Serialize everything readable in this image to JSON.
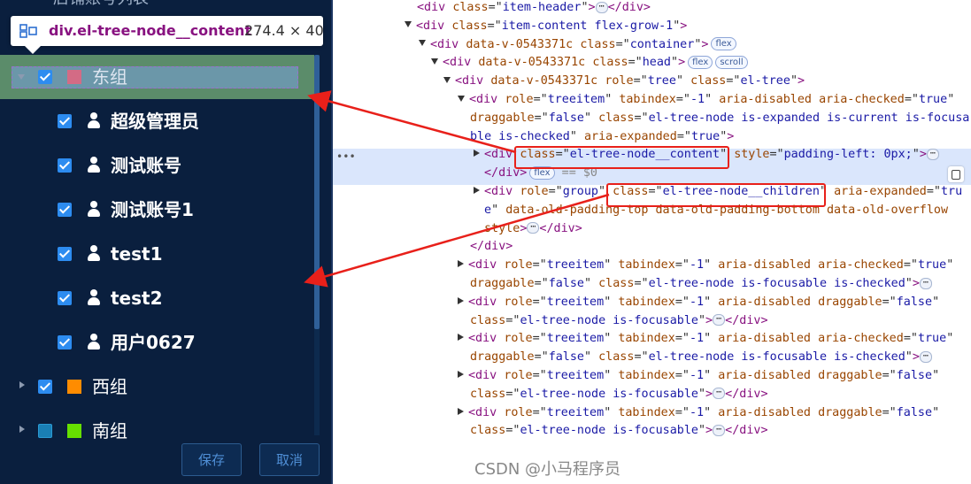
{
  "tooltip": {
    "selector": "div.el-tree-node__content",
    "size": "274.4 × 40"
  },
  "tree": {
    "partial_header": "店铺账号列表",
    "groups": [
      {
        "label": "东组",
        "color": "#d36b85",
        "expanded": true,
        "checked": true,
        "children": [
          {
            "label": "超级管理员",
            "checked": true
          },
          {
            "label": "测试账号",
            "checked": true
          },
          {
            "label": "测试账号1",
            "checked": true
          },
          {
            "label": "test1",
            "checked": true
          },
          {
            "label": "test2",
            "checked": true
          },
          {
            "label": "用户0627",
            "checked": true
          }
        ]
      },
      {
        "label": "西组",
        "color": "#ff8c00",
        "expanded": false,
        "checked": true
      },
      {
        "label": "南组",
        "color": "#66e000",
        "expanded": false,
        "checked": false
      }
    ]
  },
  "buttons": {
    "save": "保存",
    "cancel": "取消"
  },
  "devtools": {
    "lines": [
      {
        "segs": [
          [
            "t",
            "<div "
          ],
          [
            "a",
            "class"
          ],
          [
            "p",
            "=\""
          ],
          [
            "v",
            "item-header"
          ],
          [
            "p",
            "\""
          ],
          [
            "t",
            ">"
          ],
          [
            "dots",
            "⋯"
          ],
          [
            "t",
            "</div>"
          ]
        ]
      },
      {
        "tri": "down",
        "segs": [
          [
            "t",
            "<div "
          ],
          [
            "a",
            "class"
          ],
          [
            "p",
            "=\""
          ],
          [
            "v",
            "item-content flex-grow-1"
          ],
          [
            "p",
            "\""
          ],
          [
            "t",
            ">"
          ]
        ]
      },
      {
        "tri": "down",
        "segs": [
          [
            "t",
            "<div "
          ],
          [
            "a",
            "data-v-0543371c "
          ],
          [
            "a",
            "class"
          ],
          [
            "p",
            "=\""
          ],
          [
            "v",
            "container"
          ],
          [
            "p",
            "\""
          ],
          [
            "t",
            ">"
          ],
          [
            "badge",
            "flex"
          ]
        ]
      },
      {
        "tri": "down",
        "segs": [
          [
            "t",
            "<div "
          ],
          [
            "a",
            "data-v-0543371c "
          ],
          [
            "a",
            "class"
          ],
          [
            "p",
            "=\""
          ],
          [
            "v",
            "head"
          ],
          [
            "p",
            "\""
          ],
          [
            "t",
            ">"
          ],
          [
            "badge",
            "flex"
          ],
          [
            "badge",
            "scroll"
          ]
        ]
      },
      {
        "tri": "down",
        "segs": [
          [
            "t",
            "<div "
          ],
          [
            "a",
            "data-v-0543371c "
          ],
          [
            "a",
            "role"
          ],
          [
            "p",
            "=\""
          ],
          [
            "v",
            "tree"
          ],
          [
            "p",
            "\" "
          ],
          [
            "a",
            "class"
          ],
          [
            "p",
            "=\""
          ],
          [
            "v",
            "el-tree"
          ],
          [
            "p",
            "\""
          ],
          [
            "t",
            ">"
          ]
        ]
      },
      {
        "tri": "down",
        "segs": [
          [
            "t",
            "<div "
          ],
          [
            "a",
            "role"
          ],
          [
            "p",
            "=\""
          ],
          [
            "v",
            "treeitem"
          ],
          [
            "p",
            "\" "
          ],
          [
            "a",
            "tabindex"
          ],
          [
            "p",
            "=\""
          ],
          [
            "v",
            "-1"
          ],
          [
            "p",
            "\" "
          ],
          [
            "a",
            "aria-disabled "
          ],
          [
            "a",
            "aria-checked"
          ],
          [
            "p",
            "=\""
          ],
          [
            "v",
            "true"
          ],
          [
            "p",
            "\""
          ]
        ]
      },
      {
        "segs": [
          [
            "a",
            "draggable"
          ],
          [
            "p",
            "=\""
          ],
          [
            "v",
            "false"
          ],
          [
            "p",
            "\" "
          ],
          [
            "a",
            "class"
          ],
          [
            "p",
            "=\""
          ],
          [
            "v",
            "el-tree-node is-expanded is-current is-focusa"
          ]
        ]
      },
      {
        "segs": [
          [
            "v",
            "ble is-checked"
          ],
          [
            "p",
            "\" "
          ],
          [
            "a",
            "aria-expanded"
          ],
          [
            "p",
            "=\""
          ],
          [
            "v",
            "true"
          ],
          [
            "p",
            "\""
          ],
          [
            "t",
            ">"
          ]
        ]
      },
      {
        "tri": "right",
        "segs": [
          [
            "t",
            "<div "
          ],
          [
            "a",
            "class"
          ],
          [
            "p",
            "=\""
          ],
          [
            "v",
            "el-tree-node__content"
          ],
          [
            "p",
            "\" "
          ],
          [
            "a",
            "style"
          ],
          [
            "p",
            "=\""
          ],
          [
            "v",
            "padding-left: 0px;"
          ],
          [
            "p",
            "\""
          ],
          [
            "t",
            ">"
          ],
          [
            "dots",
            "⋯"
          ]
        ]
      },
      {
        "segs": [
          [
            "t",
            "</div>"
          ],
          [
            "badge",
            "flex"
          ],
          [
            "g",
            " == $0"
          ]
        ]
      },
      {
        "tri": "right",
        "segs": [
          [
            "t",
            "<div "
          ],
          [
            "a",
            "role"
          ],
          [
            "p",
            "=\""
          ],
          [
            "v",
            "group"
          ],
          [
            "p",
            "\" "
          ],
          [
            "a",
            "class"
          ],
          [
            "p",
            "=\""
          ],
          [
            "v",
            "el-tree-node__children"
          ],
          [
            "p",
            "\" "
          ],
          [
            "a",
            "aria-expanded"
          ],
          [
            "p",
            "=\""
          ],
          [
            "v",
            "tru"
          ]
        ]
      },
      {
        "segs": [
          [
            "v",
            "e"
          ],
          [
            "p",
            "\" "
          ],
          [
            "a",
            "data-old-padding-top data-old-padding-bottom data-old-overflow"
          ]
        ]
      },
      {
        "segs": [
          [
            "a",
            "style"
          ],
          [
            "t",
            ">"
          ],
          [
            "dots",
            "⋯"
          ],
          [
            "t",
            "</div>"
          ]
        ]
      },
      {
        "segs": [
          [
            "t",
            "</div>"
          ]
        ]
      },
      {
        "tri": "right",
        "segs": [
          [
            "t",
            "<div "
          ],
          [
            "a",
            "role"
          ],
          [
            "p",
            "=\""
          ],
          [
            "v",
            "treeitem"
          ],
          [
            "p",
            "\" "
          ],
          [
            "a",
            "tabindex"
          ],
          [
            "p",
            "=\""
          ],
          [
            "v",
            "-1"
          ],
          [
            "p",
            "\" "
          ],
          [
            "a",
            "aria-disabled "
          ],
          [
            "a",
            "aria-checked"
          ],
          [
            "p",
            "=\""
          ],
          [
            "v",
            "true"
          ],
          [
            "p",
            "\""
          ]
        ]
      },
      {
        "segs": [
          [
            "a",
            "draggable"
          ],
          [
            "p",
            "=\""
          ],
          [
            "v",
            "false"
          ],
          [
            "p",
            "\" "
          ],
          [
            "a",
            "class"
          ],
          [
            "p",
            "=\""
          ],
          [
            "v",
            "el-tree-node is-focusable is-checked"
          ],
          [
            "p",
            "\""
          ],
          [
            "t",
            ">"
          ],
          [
            "dots",
            "⋯"
          ]
        ]
      },
      {
        "tri": "right",
        "segs": [
          [
            "t",
            "<div "
          ],
          [
            "a",
            "role"
          ],
          [
            "p",
            "=\""
          ],
          [
            "v",
            "treeitem"
          ],
          [
            "p",
            "\" "
          ],
          [
            "a",
            "tabindex"
          ],
          [
            "p",
            "=\""
          ],
          [
            "v",
            "-1"
          ],
          [
            "p",
            "\" "
          ],
          [
            "a",
            "aria-disabled "
          ],
          [
            "a",
            "draggable"
          ],
          [
            "p",
            "=\""
          ],
          [
            "v",
            "false"
          ],
          [
            "p",
            "\""
          ]
        ]
      },
      {
        "segs": [
          [
            "a",
            "class"
          ],
          [
            "p",
            "=\""
          ],
          [
            "v",
            "el-tree-node is-focusable"
          ],
          [
            "p",
            "\""
          ],
          [
            "t",
            ">"
          ],
          [
            "dots",
            "⋯"
          ],
          [
            "t",
            "</div>"
          ]
        ]
      },
      {
        "tri": "right",
        "segs": [
          [
            "t",
            "<div "
          ],
          [
            "a",
            "role"
          ],
          [
            "p",
            "=\""
          ],
          [
            "v",
            "treeitem"
          ],
          [
            "p",
            "\" "
          ],
          [
            "a",
            "tabindex"
          ],
          [
            "p",
            "=\""
          ],
          [
            "v",
            "-1"
          ],
          [
            "p",
            "\" "
          ],
          [
            "a",
            "aria-disabled "
          ],
          [
            "a",
            "aria-checked"
          ],
          [
            "p",
            "=\""
          ],
          [
            "v",
            "true"
          ],
          [
            "p",
            "\""
          ]
        ]
      },
      {
        "segs": [
          [
            "a",
            "draggable"
          ],
          [
            "p",
            "=\""
          ],
          [
            "v",
            "false"
          ],
          [
            "p",
            "\" "
          ],
          [
            "a",
            "class"
          ],
          [
            "p",
            "=\""
          ],
          [
            "v",
            "el-tree-node is-focusable is-checked"
          ],
          [
            "p",
            "\""
          ],
          [
            "t",
            ">"
          ],
          [
            "dots",
            "⋯"
          ]
        ]
      },
      {
        "tri": "right",
        "segs": [
          [
            "t",
            "<div "
          ],
          [
            "a",
            "role"
          ],
          [
            "p",
            "=\""
          ],
          [
            "v",
            "treeitem"
          ],
          [
            "p",
            "\" "
          ],
          [
            "a",
            "tabindex"
          ],
          [
            "p",
            "=\""
          ],
          [
            "v",
            "-1"
          ],
          [
            "p",
            "\" "
          ],
          [
            "a",
            "aria-disabled "
          ],
          [
            "a",
            "draggable"
          ],
          [
            "p",
            "=\""
          ],
          [
            "v",
            "false"
          ],
          [
            "p",
            "\""
          ]
        ]
      },
      {
        "segs": [
          [
            "a",
            "class"
          ],
          [
            "p",
            "=\""
          ],
          [
            "v",
            "el-tree-node is-focusable"
          ],
          [
            "p",
            "\""
          ],
          [
            "t",
            ">"
          ],
          [
            "dots",
            "⋯"
          ],
          [
            "t",
            "</div>"
          ]
        ]
      },
      {
        "tri": "right",
        "segs": [
          [
            "t",
            "<div "
          ],
          [
            "a",
            "role"
          ],
          [
            "p",
            "=\""
          ],
          [
            "v",
            "treeitem"
          ],
          [
            "p",
            "\" "
          ],
          [
            "a",
            "tabindex"
          ],
          [
            "p",
            "=\""
          ],
          [
            "v",
            "-1"
          ],
          [
            "p",
            "\" "
          ],
          [
            "a",
            "aria-disabled "
          ],
          [
            "a",
            "draggable"
          ],
          [
            "p",
            "=\""
          ],
          [
            "v",
            "false"
          ],
          [
            "p",
            "\""
          ]
        ]
      },
      {
        "segs": [
          [
            "a",
            "class"
          ],
          [
            "p",
            "=\""
          ],
          [
            "v",
            "el-tree-node is-focusable"
          ],
          [
            "p",
            "\""
          ],
          [
            "t",
            ">"
          ],
          [
            "dots",
            "⋯"
          ],
          [
            "t",
            "</div>"
          ]
        ]
      }
    ]
  },
  "watermark": "CSDN @小马程序员",
  "colors": {
    "panel_bg": "#0a1f3e",
    "checkbox": "#2d8cf0",
    "highlight_row": "#5b8c6a",
    "annotation_red": "#e8201a"
  }
}
